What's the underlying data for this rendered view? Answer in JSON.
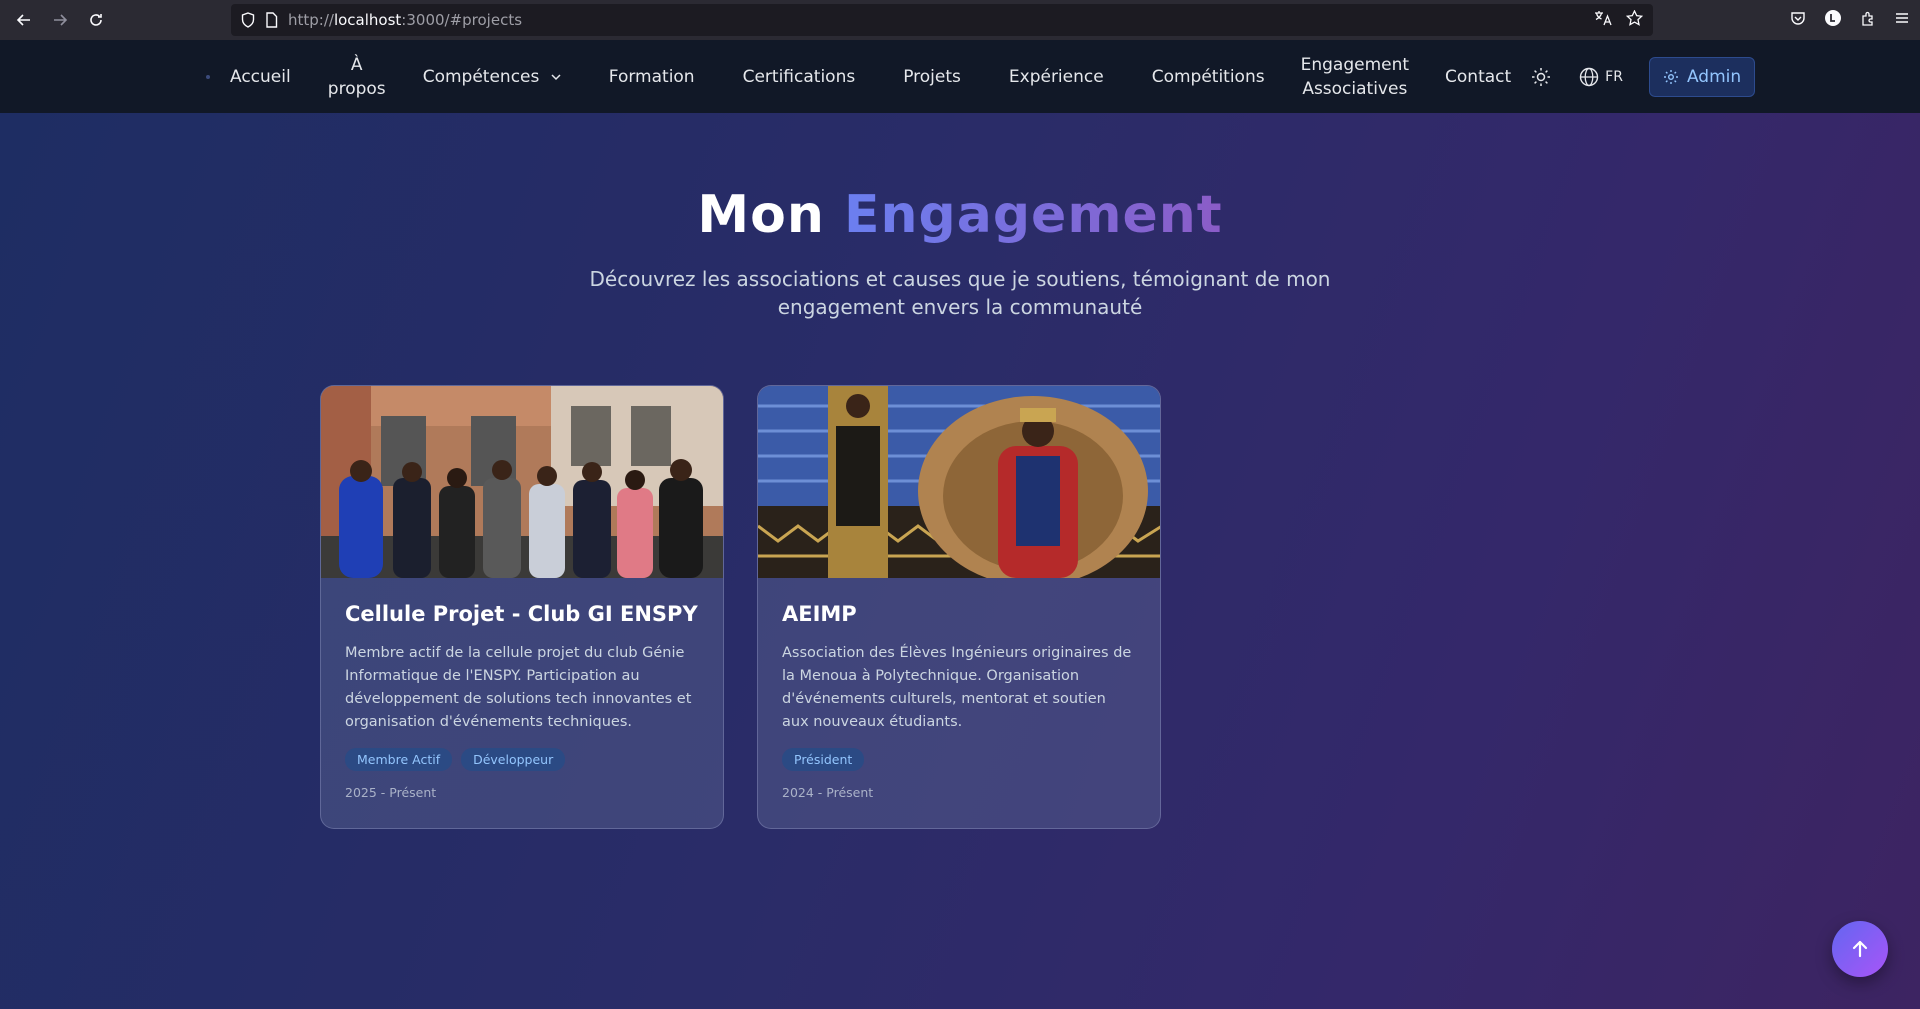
{
  "browser": {
    "url_prefix": "http://",
    "url_host": "localhost",
    "url_rest": ":3000/#projects"
  },
  "nav": {
    "home": "Accueil",
    "about_line1": "À",
    "about_line2": "propos",
    "skills": "Compétences",
    "education": "Formation",
    "certifications": "Certifications",
    "projects": "Projets",
    "experience": "Expérience",
    "competitions": "Compétitions",
    "engagement_line1": "Engagement",
    "engagement_line2": "Associatives",
    "contact": "Contact",
    "language": "FR",
    "admin": "Admin"
  },
  "section": {
    "title_plain": "Mon",
    "title_accent": "Engagement",
    "subtitle": "Découvrez les associations et causes que je soutiens, témoignant de mon engagement envers la communauté"
  },
  "cards": [
    {
      "title": "Cellule Projet - Club GI ENSPY",
      "description": "Membre actif de la cellule projet du club Génie Informatique de l'ENSPY. Participation au développement de solutions tech innovantes et organisation d'événements techniques.",
      "tags": [
        "Membre Actif",
        "Développeur"
      ],
      "period": "2025 - Présent"
    },
    {
      "title": "AEIMP",
      "description": "Association des Élèves Ingénieurs originaires de la Menoua à Polytechnique. Organisation d'événements culturels, mentorat et soutien aux nouveaux étudiants.",
      "tags": [
        "Président"
      ],
      "period": "2024 - Présent"
    }
  ],
  "colors": {
    "accent_start": "#6b7ff0",
    "accent_end": "#8b5cc7",
    "tag_bg": "#2b4a84",
    "tag_text": "#93c5fd"
  }
}
